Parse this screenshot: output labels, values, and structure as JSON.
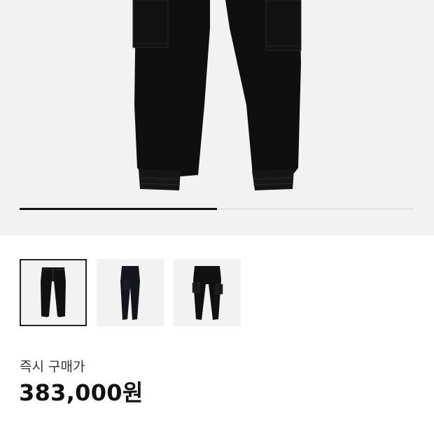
{
  "gallery": {
    "progress": 0.5,
    "thumbnails": [
      {
        "name": "thumb-front-view",
        "selected": true
      },
      {
        "name": "thumb-side-view",
        "selected": false
      },
      {
        "name": "thumb-pocket-view",
        "selected": false
      }
    ]
  },
  "price": {
    "label": "즉시 구매가",
    "value": "383,000원"
  },
  "colors": {
    "hero_bg": "#f2f2f2",
    "garment": "#0f0f0f",
    "accent": "#111111"
  }
}
